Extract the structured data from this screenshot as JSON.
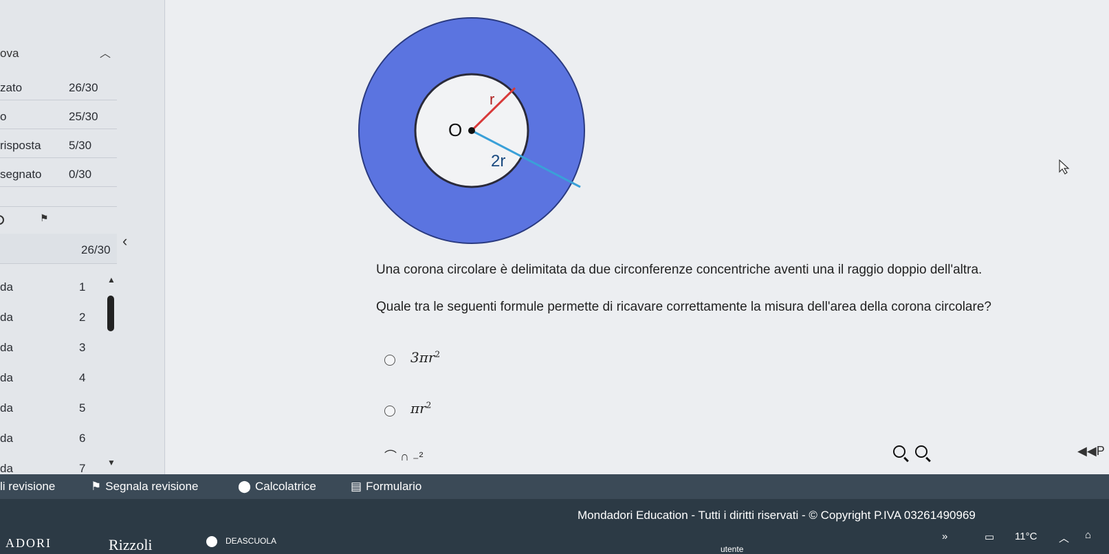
{
  "sidebar": {
    "panel_title": "ova",
    "stats": [
      {
        "label": "zato",
        "value": "26/30"
      },
      {
        "label": "o",
        "value": "25/30"
      },
      {
        "label": "risposta",
        "value": "5/30"
      },
      {
        "label": "segnato",
        "value": "0/30"
      }
    ],
    "count": "26/30",
    "questions": [
      {
        "domain": "da",
        "number": "1"
      },
      {
        "domain": "da",
        "number": "2"
      },
      {
        "domain": "da",
        "number": "3"
      },
      {
        "domain": "da",
        "number": "4"
      },
      {
        "domain": "da",
        "number": "5"
      },
      {
        "domain": "da",
        "number": "6"
      },
      {
        "domain": "da",
        "number": "7"
      }
    ]
  },
  "figure": {
    "center_label": "O",
    "inner_radius_label": "r",
    "outer_radius_label": "2r",
    "ring_color": "#5b74e0",
    "inner_color": "#f2f3f5",
    "inner_line_color": "#d83a3a",
    "outer_line_color": "#3aa0d8"
  },
  "question": {
    "line1": "Una corona circolare è delimitata da due circonferenze concentriche aventi una il raggio doppio dell'altra.",
    "line2": "Quale tra le seguenti formule permette di ricavare correttamente la misura dell'area della corona circolare?"
  },
  "options": [
    {
      "base": "3πr",
      "exp": "2"
    },
    {
      "base": "πr",
      "exp": "2"
    }
  ],
  "partial_option": "⌒ ∩ ₋²",
  "toolbar": {
    "review_label": "li revisione",
    "flag_label": "Segnala revisione",
    "calc_label": "Calcolatrice",
    "formula_label": "Formulario",
    "prev_label": "P"
  },
  "footer": {
    "copyright": "Mondadori Education - Tutti i diritti riservati - © Copyright P.IVA 03261490969",
    "brand_a": "ADORI",
    "brand_b": "Rizzoli",
    "brand_c": "DEASCUOLA",
    "user": "utente"
  },
  "taskbar": {
    "temperature": "11°C"
  }
}
